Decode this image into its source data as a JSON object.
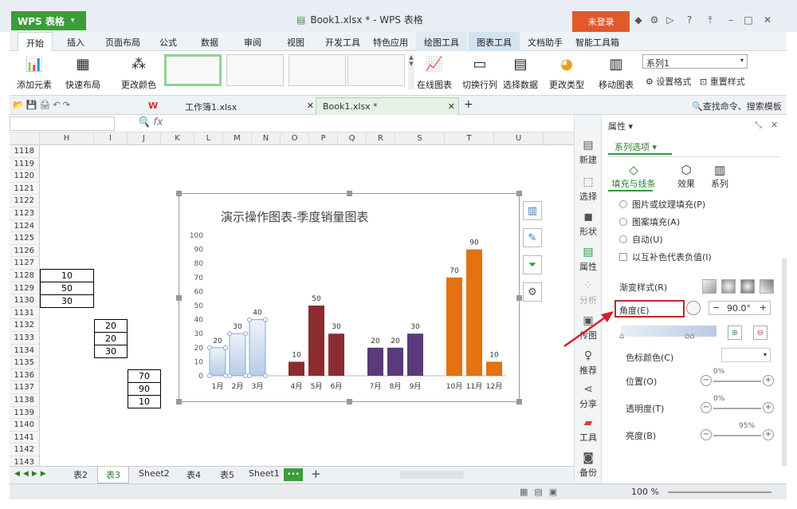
{
  "app": {
    "name": "WPS 表格",
    "title": "Book1.xlsx * - WPS 表格",
    "login": "未登录"
  },
  "menu": [
    "开始",
    "插入",
    "页面布局",
    "公式",
    "数据",
    "审阅",
    "视图",
    "开发工具",
    "特色应用",
    "绘图工具",
    "图表工具",
    "文档助手",
    "智能工具箱"
  ],
  "ribbon": {
    "add_element": "添加元素",
    "quick_layout": "快速布局",
    "change_color": "更改颜色",
    "online_chart": "在线图表",
    "switch_rowcol": "切换行列",
    "select_data": "选择数据",
    "change_type": "更改类型",
    "move_chart": "移动图表",
    "series_select": "系列1",
    "set_format": "设置格式",
    "reset_style": "重置样式"
  },
  "file_tabs": [
    "工作簿1.xlsx",
    "Book1.xlsx *"
  ],
  "search_text": "查找命令、搜索模板",
  "columns": [
    "H",
    "I",
    "J",
    "K",
    "L",
    "M",
    "N",
    "O",
    "P",
    "Q",
    "R",
    "S",
    "T",
    "U"
  ],
  "rows": [
    "1118",
    "1119",
    "1120",
    "1121",
    "1122",
    "1123",
    "1124",
    "1125",
    "1126",
    "1127",
    "1128",
    "1129",
    "1130",
    "1131",
    "1132",
    "1133",
    "1134",
    "1135",
    "1136",
    "1137",
    "1138",
    "1139",
    "1140",
    "1141",
    "1142",
    "1143"
  ],
  "cells": {
    "h1128": "10",
    "h1129": "50",
    "h1130": "30",
    "i1132": "20",
    "i1133": "20",
    "i1134": "30",
    "j1136": "70",
    "j1137": "90",
    "j1138": "10"
  },
  "sheets": [
    "表2",
    "表3",
    "Sheet2",
    "表4",
    "表5",
    "Sheet1"
  ],
  "sheet_more": "•••",
  "zoom": "100 %",
  "vbar": [
    "新建",
    "选择",
    "形状",
    "属性",
    "分析",
    "传图",
    "推荐",
    "分享",
    "工具",
    "备份"
  ],
  "panel": {
    "title": "属性",
    "series_options": "系列选项",
    "tabs": [
      "填充与线条",
      "效果",
      "系列"
    ],
    "fill_options": [
      "图片或纹理填充(P)",
      "图案填充(A)",
      "自动(U)"
    ],
    "invert_neg": "以互补色代表负值(I)",
    "gradient_style": "渐变样式(R)",
    "angle_label": "角度(E)",
    "angle_value": "90.0°",
    "stop_color": "色标颜色(C)",
    "position": "位置(O)",
    "position_val": "0%",
    "transparency": "透明度(T)",
    "transparency_val": "0%",
    "brightness": "亮度(B)",
    "brightness_val": "95%"
  },
  "colors": {
    "blue_fill": "#c9d9ec",
    "dark_red": "#8b2c2f",
    "purple": "#5a3a7a",
    "orange": "#e5720f"
  },
  "chart_data": {
    "type": "bar",
    "title": "演示操作图表-季度销量图表",
    "categories": [
      "1月",
      "2月",
      "3月",
      "4月",
      "5月",
      "6月",
      "7月",
      "8月",
      "9月",
      "10月",
      "11月",
      "12月"
    ],
    "values": [
      20,
      30,
      40,
      10,
      50,
      30,
      20,
      20,
      30,
      70,
      90,
      10
    ],
    "ylim": [
      0,
      100
    ],
    "yticks": [
      "0",
      "10",
      "20",
      "30",
      "40",
      "50",
      "60",
      "70",
      "80",
      "90",
      "100"
    ]
  }
}
